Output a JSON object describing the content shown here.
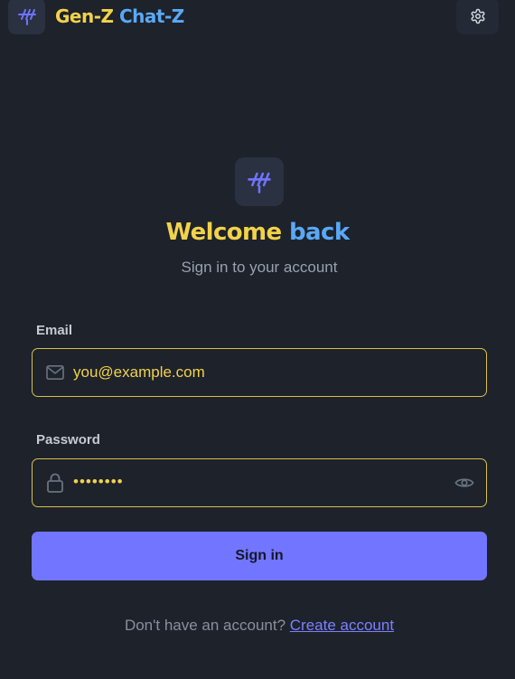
{
  "header": {
    "logo_icon": "tally-marks-icon",
    "brand_part1": "Gen-Z",
    "brand_part2": "Chat-Z",
    "settings_icon": "gear-icon"
  },
  "hero": {
    "logo_icon": "tally-marks-icon",
    "title_part1": "Welcome",
    "title_part2": "back",
    "subtitle": "Sign in to your account"
  },
  "form": {
    "email": {
      "label": "Email",
      "value": "you@example.com",
      "icon": "mail-icon"
    },
    "password": {
      "label": "Password",
      "masked_value": "••••••••",
      "icon": "lock-icon",
      "toggle_icon": "eye-icon"
    },
    "submit_label": "Sign in"
  },
  "footer": {
    "prompt": "Don't have an account?",
    "link": "Create account"
  },
  "colors": {
    "background": "#1d222b",
    "accent_yellow": "#f2d24a",
    "accent_blue": "#5aa8f5",
    "button": "#7275ff"
  }
}
